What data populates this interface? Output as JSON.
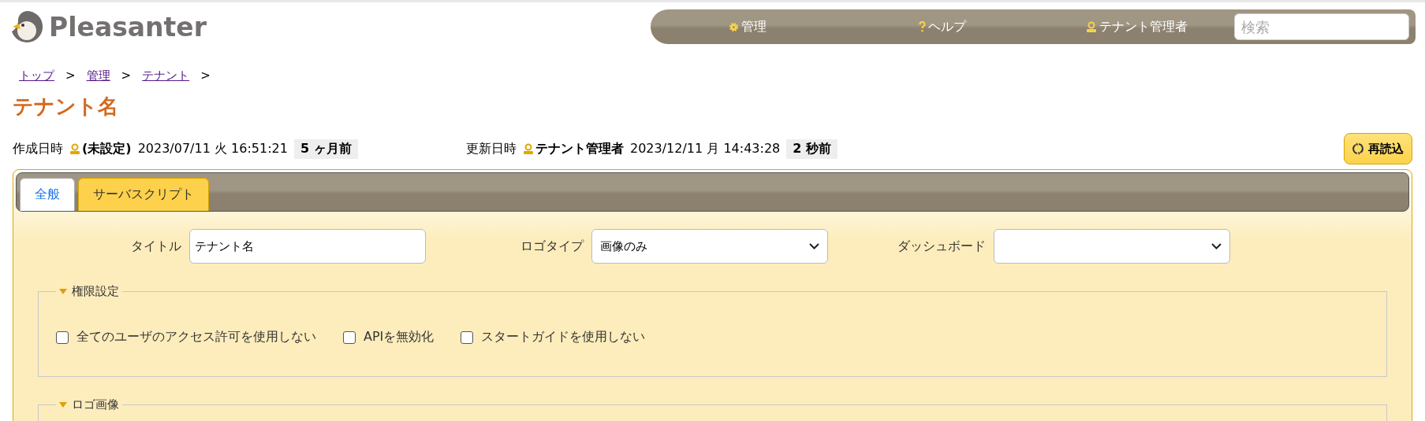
{
  "header": {
    "logo": "Pleasanter",
    "nav": [
      {
        "kind": "gear",
        "label": "管理"
      },
      {
        "kind": "help",
        "label": "ヘルプ"
      },
      {
        "kind": "user",
        "label": "テナント管理者"
      }
    ],
    "search": {
      "placeholder": "検索"
    }
  },
  "breadcrumb": {
    "separator": ">",
    "items": [
      "トップ",
      "管理",
      "テナント"
    ]
  },
  "title": "テナント名",
  "meta": [
    {
      "label": "作成日時",
      "user": "(未設定)",
      "date": "2023/07/11 火 16:51:21",
      "ago": "5 ヶ月前"
    },
    {
      "label": "更新日時",
      "user": "テナント管理者",
      "date": "2023/12/11 月 14:43:28",
      "ago": "2 秒前"
    }
  ],
  "reload_button": "再読込",
  "tabs": [
    {
      "label": "全般",
      "selected": true
    },
    {
      "label": "サーバスクリプト",
      "selected": false
    }
  ],
  "fields": [
    {
      "kind": "input",
      "label": "タイトル",
      "value": "テナント名"
    },
    {
      "kind": "select",
      "label": "ロゴタイプ",
      "value": "画像のみ"
    },
    {
      "kind": "select",
      "label": "ダッシュボード"
    }
  ],
  "fieldsets": [
    {
      "legend": "権限設定",
      "checkboxes": [
        {
          "label": "全てのユーザのアクセス許可を使用しない",
          "checked": false
        },
        {
          "label": "APIを無効化",
          "checked": false
        },
        {
          "label": "スタートガイドを使用しない",
          "checked": false
        }
      ]
    },
    {
      "legend": "ロゴ画像"
    }
  ]
}
